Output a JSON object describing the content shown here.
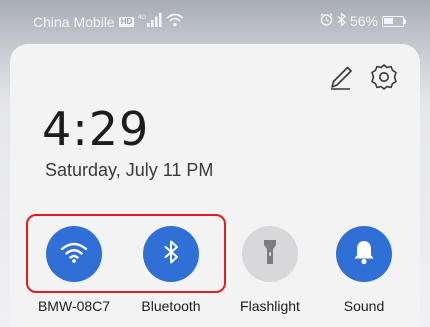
{
  "status_bar": {
    "carrier": "China Mobile",
    "hd_badge": "HD",
    "network": "4G",
    "battery_percent": "56%",
    "battery_level": 0.56
  },
  "colors": {
    "tile_active": "#2f6fd6",
    "tile_inactive": "#d8d8db",
    "highlight": "#e02020"
  },
  "panel": {
    "icons": {
      "edit": "edit-pencil-icon",
      "settings": "settings-gear-icon"
    },
    "time": "4:29",
    "date": "Saturday, July 11  PM"
  },
  "toggles": [
    {
      "label": "BMW-08C7",
      "icon": "wifi-icon",
      "active": true
    },
    {
      "label": "Bluetooth",
      "icon": "bluetooth-icon",
      "active": true
    },
    {
      "label": "Flashlight",
      "icon": "flashlight-icon",
      "active": false
    },
    {
      "label": "Sound",
      "icon": "bell-icon",
      "active": true
    }
  ]
}
